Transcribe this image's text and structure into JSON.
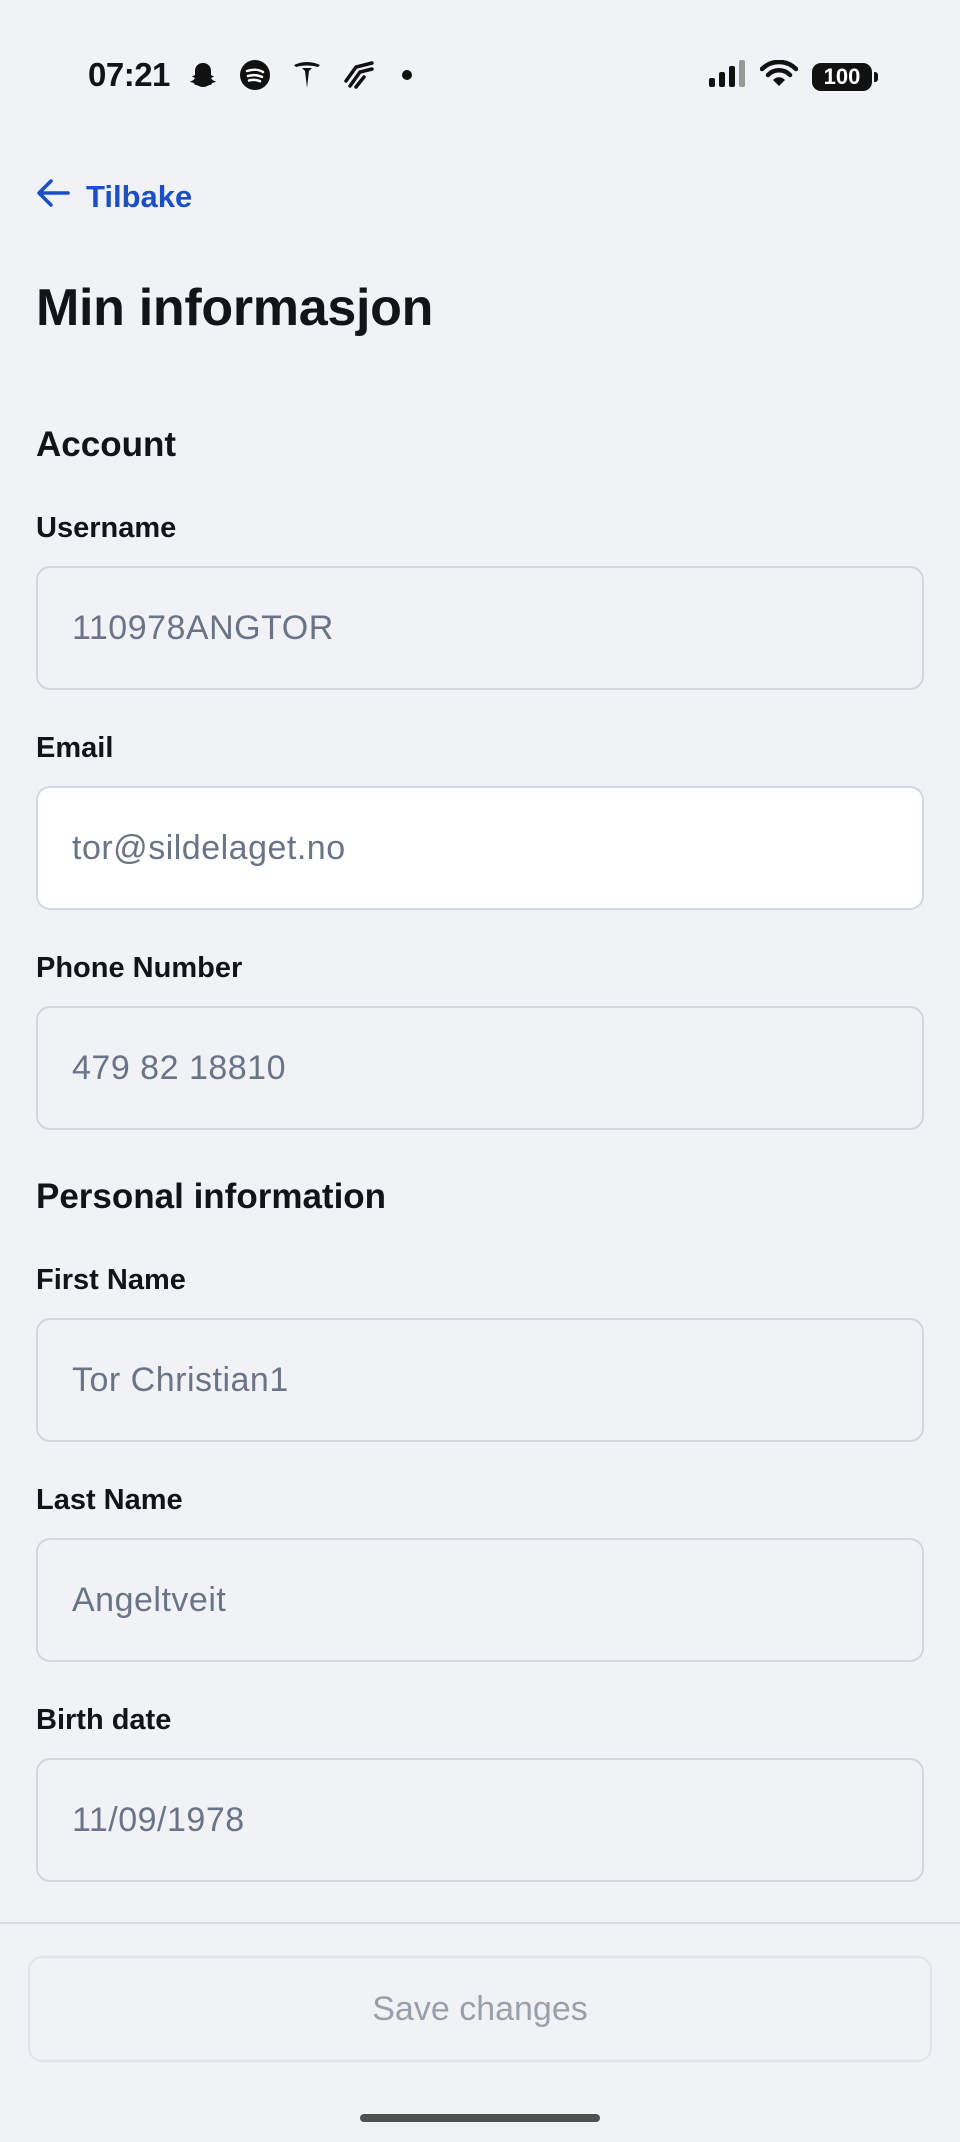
{
  "status_bar": {
    "time": "07:21",
    "battery": "100",
    "left_icons": [
      "snapchat-icon",
      "spotify-icon",
      "tesla-icon",
      "strava-icon"
    ],
    "right_icons": [
      "signal-icon",
      "wifi-icon",
      "battery-icon"
    ]
  },
  "header": {
    "back_label": "Tilbake",
    "title": "Min informasjon"
  },
  "sections": {
    "account": {
      "title": "Account",
      "username": {
        "label": "Username",
        "value": "110978ANGTOR"
      },
      "email": {
        "label": "Email",
        "value": "tor@sildelaget.no"
      },
      "phone": {
        "label": "Phone Number",
        "value": "479 82 18810"
      }
    },
    "personal": {
      "title": "Personal information",
      "first_name": {
        "label": "First Name",
        "value": "Tor Christian1"
      },
      "last_name": {
        "label": "Last Name",
        "value": "Angeltveit"
      },
      "birth_date": {
        "label": "Birth date",
        "value": "11/09/1978"
      }
    }
  },
  "footer": {
    "save_label": "Save changes"
  },
  "colors": {
    "background": "#f1f2f6",
    "accent": "#1b4fc4",
    "input_text": "#6b7487",
    "disabled_text": "#9aa0aa"
  }
}
